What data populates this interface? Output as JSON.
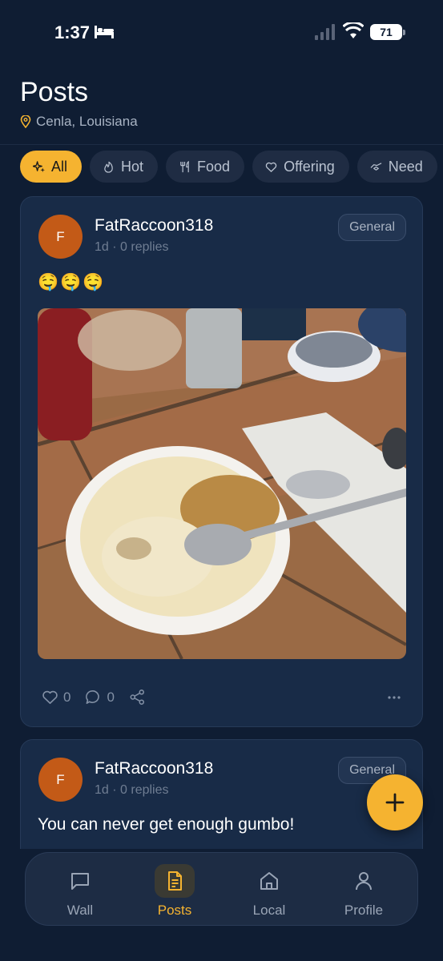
{
  "status_bar": {
    "time": "1:37",
    "battery": "71",
    "icons": [
      "bed-icon",
      "signal-icon",
      "wifi-icon",
      "battery-icon"
    ]
  },
  "header": {
    "title": "Posts",
    "location": "Cenla, Louisiana"
  },
  "chips": [
    {
      "label": "All",
      "icon": "sparkles-icon",
      "active": true
    },
    {
      "label": "Hot",
      "icon": "flame-icon",
      "active": false
    },
    {
      "label": "Food",
      "icon": "utensils-icon",
      "active": false
    },
    {
      "label": "Offering",
      "icon": "heart-icon",
      "active": false
    },
    {
      "label": "Need",
      "icon": "handshake-icon",
      "active": false
    }
  ],
  "posts": [
    {
      "avatar_initial": "F",
      "author": "FatRaccoon318",
      "meta": "1d · 0 replies",
      "category": "General",
      "text": "🤤🤤🤤",
      "image": "bowl of banana pudding with crumble topping and a spoon on a tiled table",
      "likes": "0",
      "comments": "0"
    },
    {
      "avatar_initial": "F",
      "author": "FatRaccoon318",
      "meta": "1d · 0 replies",
      "category": "General",
      "text": "You can never get enough gumbo!"
    }
  ],
  "fab": {
    "icon": "plus-icon"
  },
  "nav": [
    {
      "label": "Wall",
      "icon": "message-square-icon",
      "active": false
    },
    {
      "label": "Posts",
      "icon": "document-icon",
      "active": true
    },
    {
      "label": "Local",
      "icon": "home-icon",
      "active": false
    },
    {
      "label": "Profile",
      "icon": "user-icon",
      "active": false
    }
  ],
  "colors": {
    "background": "#0f1d33",
    "card": "#182b47",
    "accent": "#f5b330",
    "avatar": "#c35a17"
  }
}
